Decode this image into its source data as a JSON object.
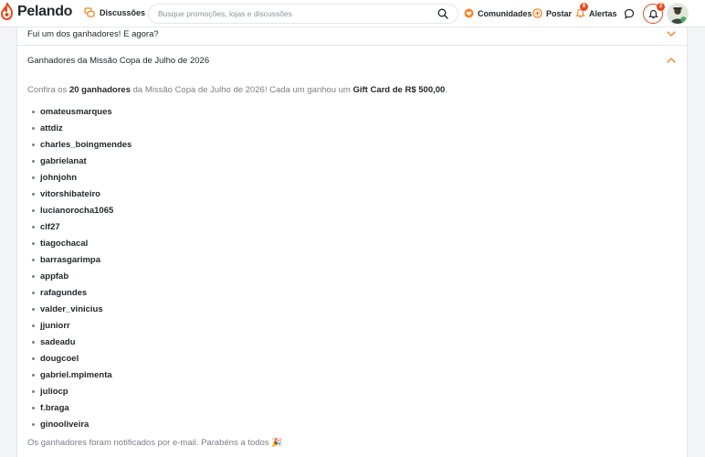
{
  "header": {
    "brand": "Pelando",
    "discussions_label": "Discussões",
    "search_placeholder": "Busque promoções, lojas e discussões",
    "communities_label": "Comunidades",
    "post_label": "Postar",
    "alerts_label": "Alertas",
    "alerts_badge": "6",
    "notifications_badge": "2",
    "colors": {
      "brand": "#e8481f",
      "accent_orange": "#f5862a",
      "text": "#24272c"
    }
  },
  "faq": {
    "previous_question": "Fui um dos ganhadores! E agora?",
    "open_question": "Ganhadores da Missão Copa de Julho de 2026",
    "intro": {
      "part1": "Confira os ",
      "count": "20 ganhadores",
      "part2": " da Missão Copa de Julho de 2026! Cada um ganhou um ",
      "prize": "Gift Card de R$ 500,00",
      "part3": "."
    },
    "winners": [
      "omateusmarques",
      "attdiz",
      "charles_boingmendes",
      "gabrielanat",
      "johnjohn",
      "vitorshibateiro",
      "lucianorocha1065",
      "clf27",
      "tiagochacal",
      "barrasgarimpa",
      "appfab",
      "rafagundes",
      "valder_vinicius",
      "jjuniorr",
      "sadeadu",
      "dougcoel",
      "gabriel.mpimenta",
      "juliocp",
      "f.braga",
      "ginooliveira"
    ],
    "outro": "Os ganhadores foram notificados por e-mail. Parabéns a todos 🎉"
  }
}
